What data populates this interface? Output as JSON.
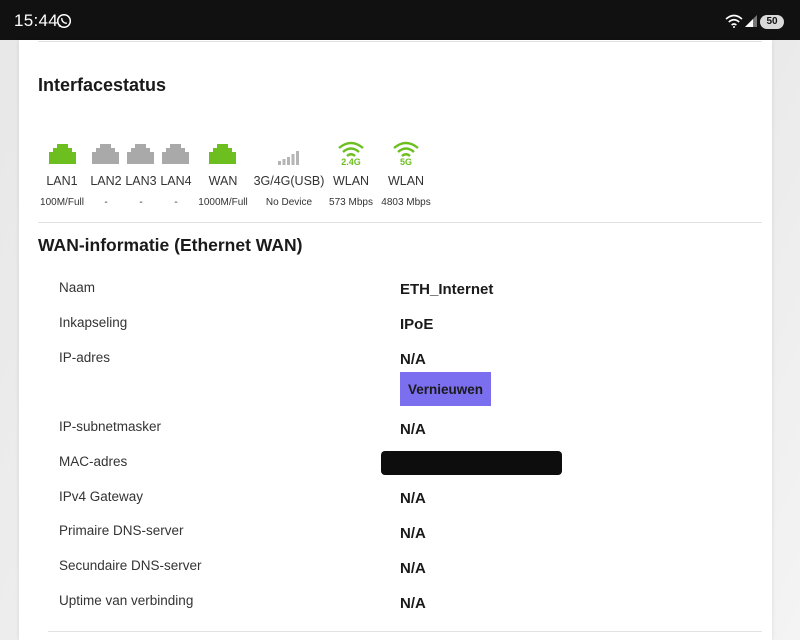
{
  "statusbar": {
    "time": "15:44",
    "battery": "50"
  },
  "interface_status": {
    "title": "Interfacestatus",
    "ports": [
      {
        "label": "LAN1",
        "status": "100M/Full",
        "icon": "ethernet-port-icon",
        "active": true
      },
      {
        "label": "LAN2",
        "status": "-",
        "icon": "ethernet-port-icon",
        "active": false
      },
      {
        "label": "LAN3",
        "status": "-",
        "icon": "ethernet-port-icon",
        "active": false
      },
      {
        "label": "LAN4",
        "status": "-",
        "icon": "ethernet-port-icon",
        "active": false
      },
      {
        "label": "WAN",
        "status": "1000M/Full",
        "icon": "ethernet-port-icon",
        "active": true
      },
      {
        "label": "3G/4G(USB)",
        "status": "No Device",
        "icon": "cellular-signal-icon",
        "active": false
      },
      {
        "label": "WLAN",
        "status": "573 Mbps",
        "icon": "wifi-icon",
        "band": "2.4G",
        "active": true
      },
      {
        "label": "WLAN",
        "status": "4803 Mbps",
        "icon": "wifi-icon",
        "band": "5G",
        "active": true
      }
    ]
  },
  "wan_info": {
    "title": "WAN-informatie (Ethernet WAN)",
    "rows": [
      {
        "label": "Naam",
        "value": "ETH_Internet"
      },
      {
        "label": "Inkapseling",
        "value": "IPoE"
      },
      {
        "label": "IP-adres",
        "value": "N/A"
      },
      {
        "label": "IP-subnetmasker",
        "value": "N/A"
      },
      {
        "label": "MAC-adres",
        "value": ""
      },
      {
        "label": "IPv4 Gateway",
        "value": "N/A"
      },
      {
        "label": "Primaire DNS-server",
        "value": "N/A"
      },
      {
        "label": "Secundaire DNS-server",
        "value": "N/A"
      },
      {
        "label": "Uptime van verbinding",
        "value": "N/A"
      }
    ],
    "renew_label": "Vernieuwen"
  },
  "colors": {
    "active_green": "#6dbf1f",
    "inactive_gray": "#a9a9a9",
    "button_purple": "#7b6ff0",
    "statusbar_bg": "#111111"
  }
}
